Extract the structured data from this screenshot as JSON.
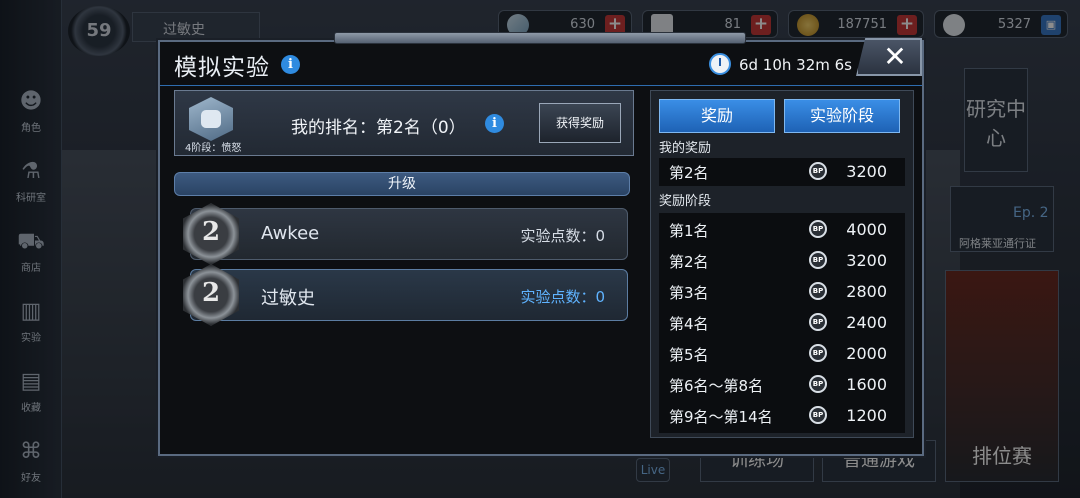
{
  "background": {
    "player_level": "59",
    "player_name": "过敏史",
    "resources": [
      {
        "name": "crystal",
        "value": "630",
        "icon": "crystal-icon",
        "action": "+"
      },
      {
        "name": "ticket",
        "value": "81",
        "icon": "ticket-icon",
        "action": "+"
      },
      {
        "name": "gold",
        "value": "187751",
        "icon": "coin-icon",
        "action": "+"
      },
      {
        "name": "bp",
        "value": "5327",
        "icon": "bp-icon",
        "action": "▣"
      }
    ],
    "rail": [
      {
        "label": "角色",
        "icon": "character-icon"
      },
      {
        "label": "科研室",
        "icon": "flask-icon"
      },
      {
        "label": "商店",
        "icon": "cart-icon"
      },
      {
        "label": "实验",
        "icon": "books-icon"
      },
      {
        "label": "收藏",
        "icon": "book-icon"
      },
      {
        "label": "好友",
        "icon": "gamepad-icon"
      }
    ],
    "side_labels": {
      "research": "研究中心",
      "pass": "阿格莱亚通行证",
      "episode": "Ep. 2",
      "ranked": "排位赛",
      "normal": "普通游戏",
      "training": "训练场",
      "live": "Live"
    }
  },
  "modal": {
    "title": "模拟实验",
    "timer": "6d 10h 32m 6s",
    "close_label": "✕",
    "stage_label": "4阶段：愤怒",
    "my_rank_text": "我的排名：第2名（0）",
    "claim_button": "获得奖励",
    "upgrade_label": "升级",
    "players": [
      {
        "rank": "2",
        "name": "Awkee",
        "points": "实验点数：0",
        "is_me": false
      },
      {
        "rank": "2",
        "name": "过敏史",
        "points": "实验点数：0",
        "is_me": true
      }
    ],
    "tabs": {
      "reward": "奖励",
      "stage": "实验阶段"
    },
    "my_reward_label": "我的奖励",
    "my_reward": {
      "rank": "第2名",
      "value": "3200"
    },
    "reward_stage_label": "奖励阶段",
    "reward_icon_text": "BP",
    "rewards": [
      {
        "rank": "第1名",
        "value": "4000"
      },
      {
        "rank": "第2名",
        "value": "3200"
      },
      {
        "rank": "第3名",
        "value": "2800"
      },
      {
        "rank": "第4名",
        "value": "2400"
      },
      {
        "rank": "第5名",
        "value": "2000"
      },
      {
        "rank": "第6名～第8名",
        "value": "1600"
      },
      {
        "rank": "第9名～第14名",
        "value": "1200"
      }
    ]
  },
  "colors": {
    "accent": "#2f8be0",
    "tab_blue": "#1e62b5",
    "plus_red": "#c63a3a"
  }
}
